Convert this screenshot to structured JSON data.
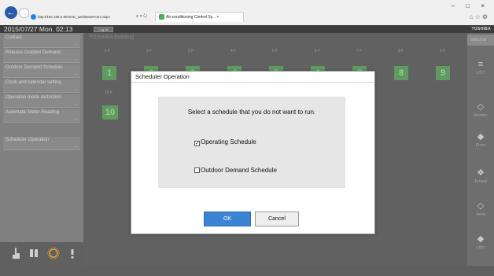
{
  "browser": {
    "url": "http://192.168.2.80/smtc_web/BaseForm.aspx",
    "address_tools": "⌕ ▾ ↻",
    "tab_title": "Air-conditioning Control Sy...",
    "tab_close": "×",
    "window_controls": "– □ ×"
  },
  "header": {
    "datetime": "2015/07/27 Mon. 02:13",
    "logout_label": "Log off",
    "brand": "TOSHIBA"
  },
  "menu": {
    "items": [
      {
        "label": "Contact",
        "dots": "..."
      },
      {
        "label": "Release Outdoor Demand",
        "dots": "..."
      },
      {
        "label": "Outdoor Demand Schedule",
        "dots": "..."
      },
      {
        "label": "Clock and calendar setting",
        "dots": "..."
      },
      {
        "label": "Operation mode restriction",
        "dots": "..."
      },
      {
        "label": "Automatic Meter-Reading",
        "dots": "..."
      },
      {
        "label": "Scheduler Operation",
        "dots": "..."
      }
    ]
  },
  "building": {
    "name": "TOSHIBA Building",
    "floor_labels": [
      "1 F",
      "2 F",
      "3 F",
      "4 F",
      "5 F",
      "6 F",
      "7 F",
      "8 F",
      "9 F",
      "10 F"
    ],
    "tiles": [
      "1",
      "2",
      "3",
      "4",
      "5",
      "6",
      "7",
      "8",
      "9",
      "10"
    ]
  },
  "right_panel": {
    "select_all": "Select all",
    "items": [
      {
        "glyph": "≡",
        "label": "LIST"
      },
      {
        "glyph": "◇",
        "label": "Monitor"
      },
      {
        "glyph": "◆",
        "label": "Floor"
      },
      {
        "glyph": "❖",
        "label": "Tenant"
      },
      {
        "glyph": "◇",
        "label": "Area"
      },
      {
        "glyph": "◆",
        "label": "Unit"
      }
    ]
  },
  "dialog": {
    "title": "Scheduler Operation",
    "prompt": "Select a schedule that you do not want to run.",
    "options": [
      {
        "label": "Operating Schedule",
        "mark": "✓"
      },
      {
        "label": "Outdoor Demand Schedule",
        "mark": ""
      }
    ],
    "ok_label": "OK",
    "cancel_label": "Cancel"
  },
  "colors": {
    "accent": "#3d83d4",
    "floor_tile": "#5f9a5f"
  }
}
